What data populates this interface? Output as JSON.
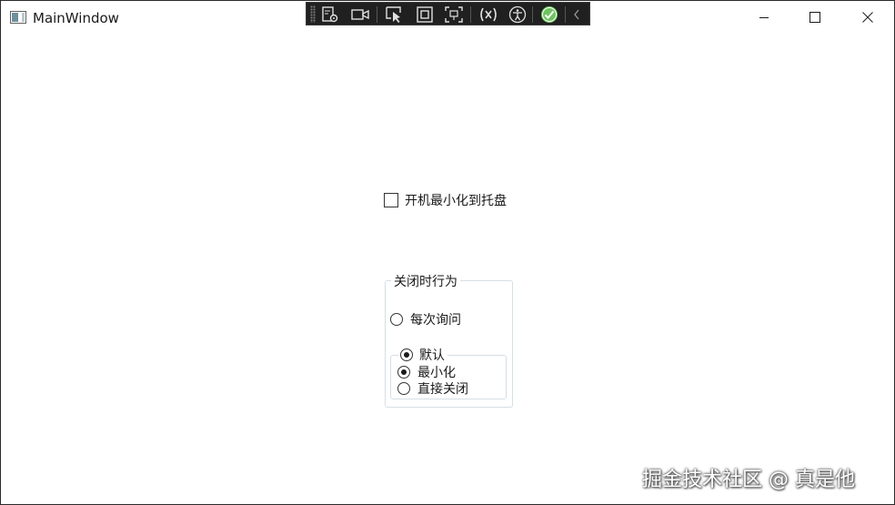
{
  "window": {
    "title": "MainWindow"
  },
  "debug_toolbar": {
    "icons": [
      "live-visual-tree-icon",
      "record-icon",
      "select-element-icon",
      "display-layout-adorners-icon",
      "track-focus-icon",
      "binding-failures-icon",
      "accessibility-icon",
      "hot-reload-ok-icon",
      "collapse-toolbar-icon"
    ]
  },
  "settings": {
    "minimize_to_tray_label": "开机最小化到托盘",
    "minimize_to_tray_checked": false,
    "close_behavior": {
      "group_label": "关闭时行为",
      "ask_each_time_label": "每次询问",
      "ask_each_time_checked": false,
      "default_label": "默认",
      "default_checked": true,
      "options": [
        {
          "label": "最小化",
          "checked": true
        },
        {
          "label": "直接关闭",
          "checked": false
        }
      ]
    }
  },
  "watermark": "掘金技术社区 @ 真是他",
  "colors": {
    "toolbar_bg": "#202020",
    "hot_reload_ok": "#6fc35f",
    "group_border": "#d5dfe5"
  }
}
